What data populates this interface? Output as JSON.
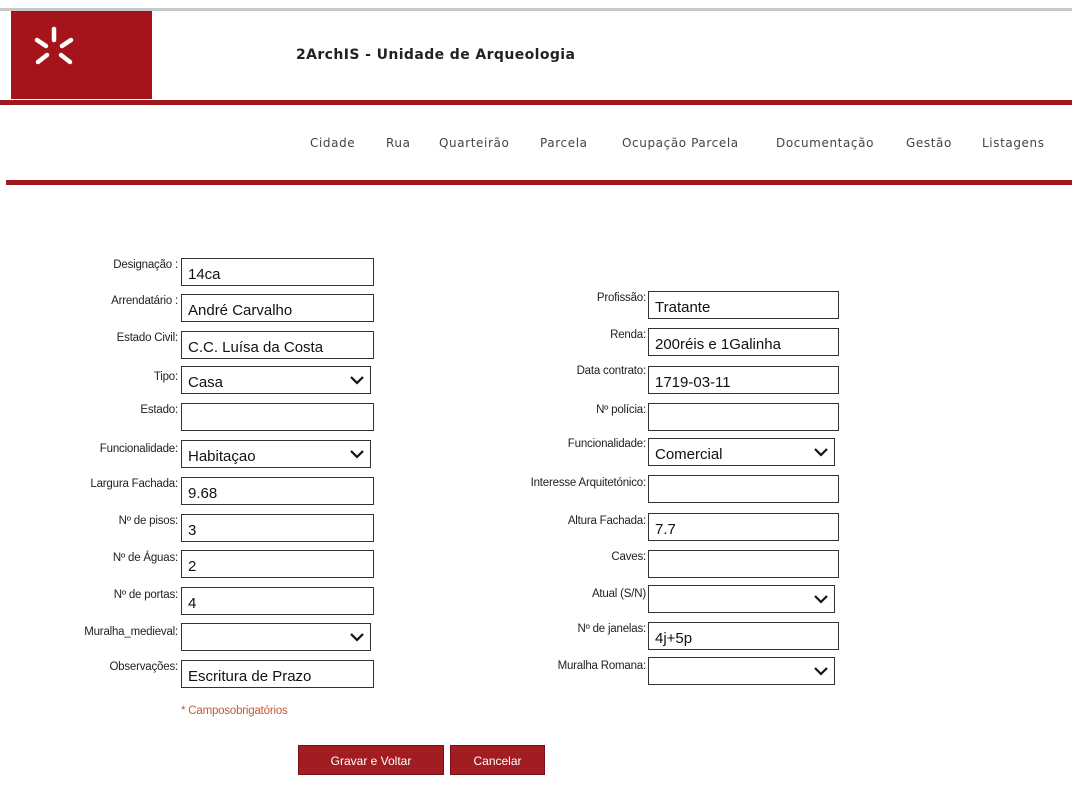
{
  "header": {
    "title": "2ArchIS - Unidade de Arqueologia",
    "logo_icon": "university-star-logo-icon",
    "accent_color": "#9e1a20"
  },
  "nav": {
    "items": [
      "Cidade",
      "Rua",
      "Quarteirão",
      "Parcela",
      "Ocupação Parcela",
      "Documentação",
      "Gestão",
      "Listagens"
    ]
  },
  "form": {
    "left": {
      "designacao": {
        "label": "Designação :",
        "value": "14ca"
      },
      "arrendatario": {
        "label": "Arrendatário :",
        "value": "André Carvalho"
      },
      "estado_civil": {
        "label": "Estado Civil:",
        "value": "C.C. Luísa da Costa"
      },
      "tipo": {
        "label": "Tipo:",
        "value": "Casa"
      },
      "estado": {
        "label": "Estado:",
        "value": ""
      },
      "funcionalidade": {
        "label": "Funcionalidade:",
        "value": "Habitaçao"
      },
      "largura_fachada": {
        "label": "Largura Fachada:",
        "value": "9.68"
      },
      "n_pisos": {
        "label": "Nº de pisos:",
        "value": "3"
      },
      "n_aguas": {
        "label": "Nº de Águas:",
        "value": "2"
      },
      "n_portas": {
        "label": "Nº de portas:",
        "value": "4"
      },
      "muralha_medieval": {
        "label": "Muralha_medieval:",
        "value": ""
      },
      "observacoes": {
        "label": "Observações:",
        "value": "Escritura de Prazo"
      }
    },
    "right": {
      "profissao": {
        "label": "Profissão:",
        "value": "Tratante"
      },
      "renda": {
        "label": "Renda:",
        "value": "200réis e 1Galinha"
      },
      "data_contrato": {
        "label": "Data contrato:",
        "value": "1719-03-11"
      },
      "n_policia": {
        "label": "Nº polícia:",
        "value": ""
      },
      "funcionalidade": {
        "label": "Funcionalidade:",
        "value": "Comercial"
      },
      "interesse_arquitetonico": {
        "label": "Interesse Arquitetónico:",
        "value": ""
      },
      "altura_fachada": {
        "label": "Altura Fachada:",
        "value": "7.7"
      },
      "caves": {
        "label": "Caves:",
        "value": ""
      },
      "atual": {
        "label": "Atual (S/N)",
        "value": ""
      },
      "n_janelas": {
        "label": "Nº de janelas:",
        "value": "4j+5p"
      },
      "muralha_romana": {
        "label": "Muralha Romana:",
        "value": ""
      }
    },
    "required_note": "* Camposobrigatórios"
  },
  "buttons": {
    "save": "Gravar e Voltar",
    "cancel": "Cancelar"
  }
}
